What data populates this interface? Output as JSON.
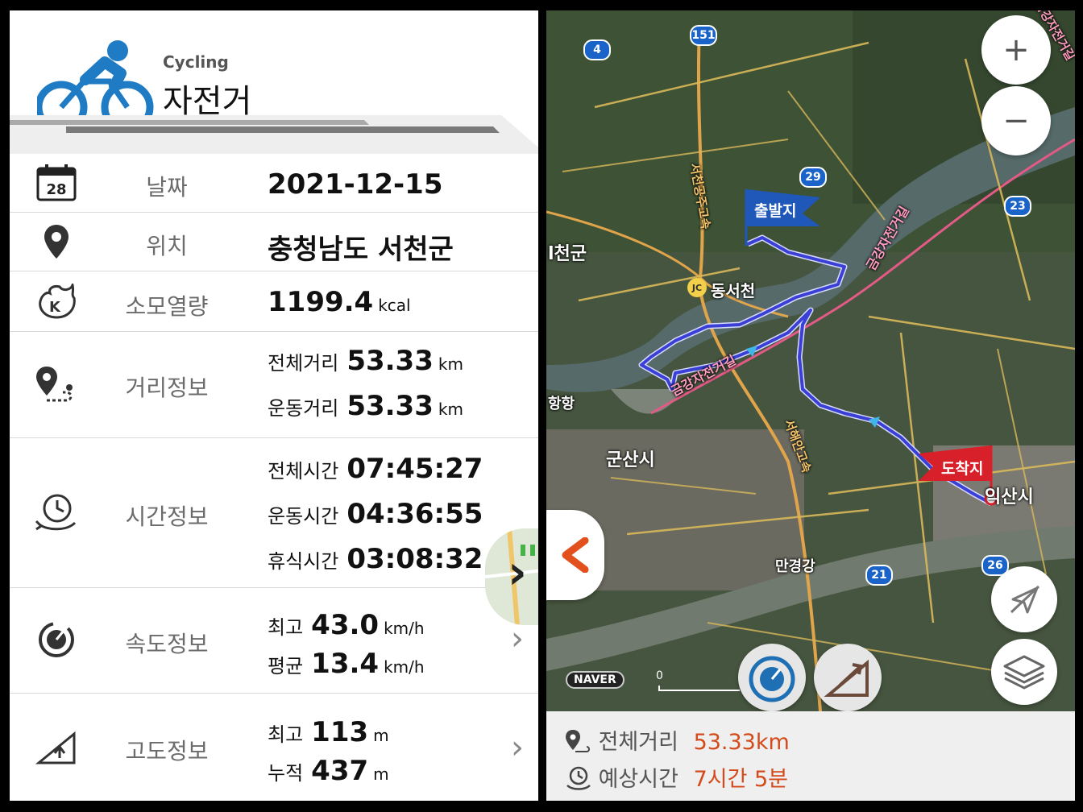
{
  "header": {
    "subtitle": "Cycling",
    "title": "자전거"
  },
  "rows": {
    "date": {
      "label": "날짜",
      "value": "2021-12-15",
      "icon_text": "28"
    },
    "location": {
      "label": "위치",
      "value": "충청남도 서천군"
    },
    "calories": {
      "label": "소모열량",
      "value": "1199.4",
      "unit": "kcal"
    },
    "distance": {
      "label": "거리정보",
      "total": {
        "key": "전체거리",
        "value": "53.33",
        "unit": "km"
      },
      "moving": {
        "key": "운동거리",
        "value": "53.33",
        "unit": "km"
      }
    },
    "time": {
      "label": "시간정보",
      "total": {
        "key": "전체시간",
        "value": "07:45:27"
      },
      "moving": {
        "key": "운동시간",
        "value": "04:36:55"
      },
      "rest": {
        "key": "휴식시간",
        "value": "03:08:32"
      }
    },
    "speed": {
      "label": "속도정보",
      "max": {
        "key": "최고",
        "value": "43.0",
        "unit": "km/h"
      },
      "avg": {
        "key": "평균",
        "value": "13.4",
        "unit": "km/h"
      }
    },
    "altitude": {
      "label": "고도정보",
      "max": {
        "key": "최고",
        "value": "113",
        "unit": "m"
      },
      "cumulative": {
        "key": "누적",
        "value": "437",
        "unit": "m"
      }
    }
  },
  "map": {
    "start_flag": "출발지",
    "end_flag": "도착지",
    "zoom_in": "+",
    "zoom_out": "−",
    "logo": "NAVER",
    "scale_label": "0",
    "labels": {
      "cheongun": "l천군",
      "jc": "JC",
      "dongseocheon": "동서천",
      "hanghang": "항항",
      "gunsan": "군산시",
      "iksan": "익산시",
      "mangyeong": "만경강",
      "bikeroad1": "금강자전거길",
      "bikeroad2": "금강자전거길",
      "highway1": "서천공주고속",
      "highway2": "서해안고속",
      "top_right": "금강자전거길"
    },
    "shields": {
      "s151": "151",
      "s4": "4",
      "s29": "29",
      "s23": "23",
      "s21": "21",
      "s26": "26"
    },
    "bottom": {
      "distance_key": "전체거리",
      "distance_value": "53.33km",
      "time_key": "예상시간",
      "time_value": "7시간 5분"
    }
  },
  "colors": {
    "accent": "#1e7bc4",
    "route": "#3a3fd6",
    "highlight": "#d44a1a",
    "end_flag": "#d8202a",
    "start_flag": "#1f58b8"
  }
}
